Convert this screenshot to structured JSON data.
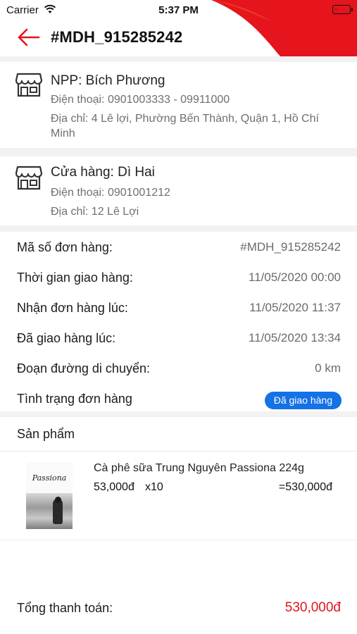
{
  "status_bar": {
    "carrier": "Carrier",
    "time": "5:37 PM",
    "battery_level": 0.2
  },
  "header": {
    "title": "#MDH_915285242",
    "accent_color": "#e5141d"
  },
  "distributor": {
    "name": "NPP: Bích Phương",
    "phone": "Điện thoại: 0901003333 - 09911000",
    "address": "Địa chỉ: 4 Lê lợi, Phường Bến Thành,  Quận 1, Hồ Chí Minh",
    "icon": "store-icon"
  },
  "store": {
    "name": "Cửa hàng: Dì Hai",
    "phone": "Điện thoại: 0901001212",
    "address": "Địa chỉ: 12 Lê Lợi",
    "icon": "store-icon"
  },
  "order_info": [
    {
      "label": "Mã số đơn hàng:",
      "value": "#MDH_915285242"
    },
    {
      "label": "Thời gian giao hàng:",
      "value": "11/05/2020 00:00"
    },
    {
      "label": "Nhận đơn hàng lúc:",
      "value": "11/05/2020 11:37"
    },
    {
      "label": "Đã giao hàng lúc:",
      "value": "11/05/2020 13:34"
    },
    {
      "label": "Đoạn đường di chuyển:",
      "value": "0 km"
    },
    {
      "label": "Tình trạng đơn hàng",
      "value": "Đã giao hàng"
    }
  ],
  "status_color": "#1471e6",
  "products_section": {
    "title": "Sản phẩm",
    "items": [
      {
        "name": "Cà phê sữa Trung Nguyên Passiona 224g",
        "price": "53,000đ",
        "quantity": "x10",
        "line_total": "=530,000đ",
        "image_brand": "Passiona"
      }
    ]
  },
  "summary": {
    "total_label": "Tổng thanh toán:",
    "total_value": "530,000đ",
    "total_color": "#e0141e"
  }
}
